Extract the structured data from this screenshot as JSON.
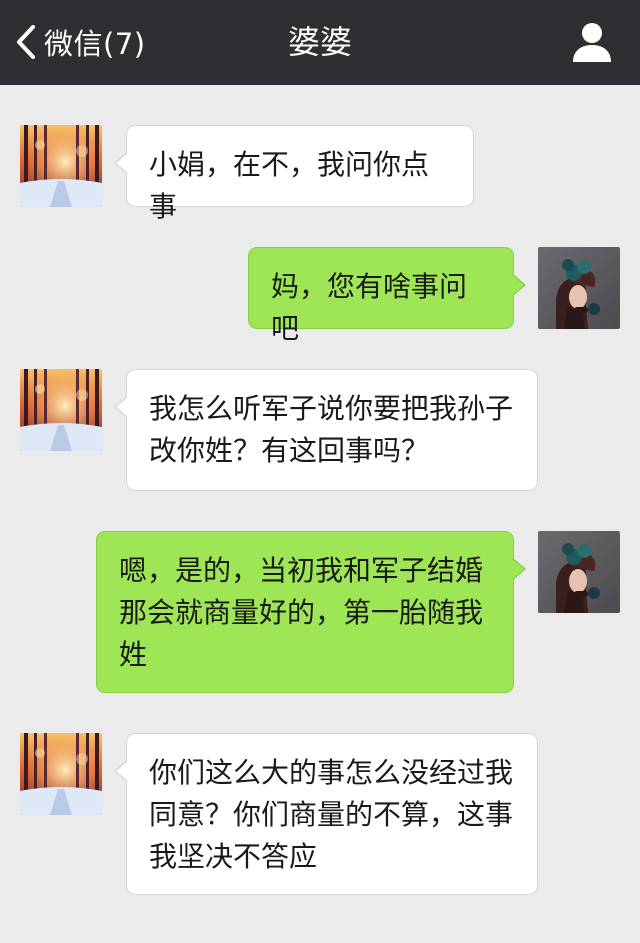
{
  "header": {
    "back_label": "微信(7)",
    "title": "婆婆",
    "back_icon": "chevron-left-icon",
    "profile_icon": "person-icon"
  },
  "colors": {
    "topbar": "#2f2f33",
    "background": "#ebebeb",
    "outgoing_bubble": "#9ee656",
    "incoming_bubble": "#ffffff"
  },
  "messages": [
    {
      "sender": "婆婆",
      "direction": "incoming",
      "text": "小娟，在不，我问你点事"
    },
    {
      "sender": "me",
      "direction": "outgoing",
      "text": "妈，您有啥事问吧"
    },
    {
      "sender": "婆婆",
      "direction": "incoming",
      "text": "我怎么听军子说你要把我孙子改你姓？有这回事吗？"
    },
    {
      "sender": "me",
      "direction": "outgoing",
      "text": "嗯，是的，当初我和军子结婚那会就商量好的，第一胎随我姓"
    },
    {
      "sender": "婆婆",
      "direction": "incoming",
      "text": "你们这么大的事怎么没经过我同意？你们商量的不算，这事我坚决不答应"
    }
  ]
}
